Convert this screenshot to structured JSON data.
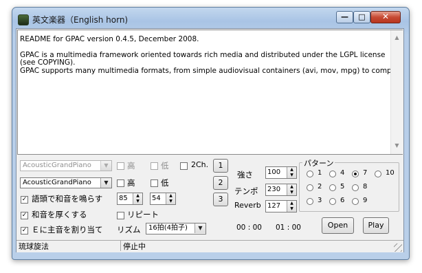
{
  "window": {
    "title": "英文楽器（English horn)",
    "minimize_glyph": "—",
    "maximize_glyph": "□",
    "close_glyph": "✕"
  },
  "text_area": {
    "lines": [
      "README for GPAC version 0.4.5, December 2008.",
      "",
      "GPAC is a multimedia framework oriented towards rich media and distributed under the LGPL license",
      "(see COPYING).",
      "GPAC supports many multimedia formats, from simple audiovisual containers (avi, mov, mpg) to complex"
    ],
    "scroll_up": "▲",
    "scroll_down": "▼"
  },
  "controls": {
    "instrument1": "AcousticGrandPiano",
    "instrument2": "AcousticGrandPiano",
    "high": "高",
    "low": "低",
    "two_ch": "2Ch.",
    "track_buttons": [
      "1",
      "2",
      "3"
    ],
    "chord_head": "語頭で和音を鳴らす",
    "chord_thick": "和音を厚くする",
    "e_main": "Ｅに主音を割り当て",
    "repeat": "リピート",
    "rhythm_label": "リズム",
    "rhythm_value": "16拍(4拍子)",
    "spin1": "85",
    "spin2": "54",
    "strength_label": "強さ",
    "strength_value": "100",
    "tempo_label": "テンポ",
    "tempo_value": "230",
    "reverb_label": "Reverb",
    "reverb_value": "127",
    "time_start": "00 : 00",
    "time_end": "01 : 00",
    "open_button": "Open",
    "play_button": "Play",
    "checked_mark": "✓"
  },
  "pattern": {
    "title": "パターン",
    "options": [
      "1",
      "4",
      "7",
      "10",
      "2",
      "5",
      "8",
      "3",
      "6",
      "9"
    ],
    "selected": "7"
  },
  "status": {
    "left": "琉球旋法",
    "right": "停止中"
  }
}
